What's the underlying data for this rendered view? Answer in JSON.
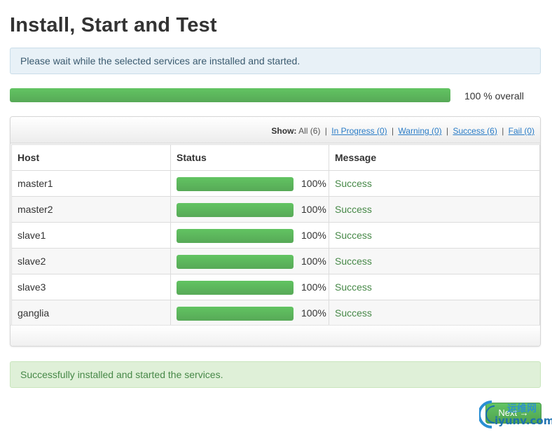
{
  "page": {
    "title": "Install, Start and Test",
    "info_message": "Please wait while the selected services are installed and started.",
    "overall_progress": 1.0,
    "overall_label": "100 % overall",
    "success_message": "Successfully installed and started the services."
  },
  "filter": {
    "show_label": "Show:",
    "all": "All (6)",
    "in_progress": "In Progress (0)",
    "warning": "Warning (0)",
    "success": "Success (6)",
    "fail": "Fail (0)",
    "separator": "|"
  },
  "table": {
    "headers": {
      "host": "Host",
      "status": "Status",
      "message": "Message"
    },
    "rows": [
      {
        "host": "master1",
        "progress": 1.0,
        "percent": "100%",
        "message": "Success"
      },
      {
        "host": "master2",
        "progress": 1.0,
        "percent": "100%",
        "message": "Success"
      },
      {
        "host": "slave1",
        "progress": 1.0,
        "percent": "100%",
        "message": "Success"
      },
      {
        "host": "slave2",
        "progress": 1.0,
        "percent": "100%",
        "message": "Success"
      },
      {
        "host": "slave3",
        "progress": 1.0,
        "percent": "100%",
        "message": "Success"
      },
      {
        "host": "ganglia",
        "progress": 1.0,
        "percent": "100%",
        "message": "Success"
      }
    ]
  },
  "actions": {
    "next_label": "Next →"
  },
  "watermark": {
    "line1": "运维网",
    "line2": "iyunv.com"
  },
  "colors": {
    "progress_green": "#5cb85c",
    "success_text": "#468847",
    "link_blue": "#2a7cc7"
  }
}
